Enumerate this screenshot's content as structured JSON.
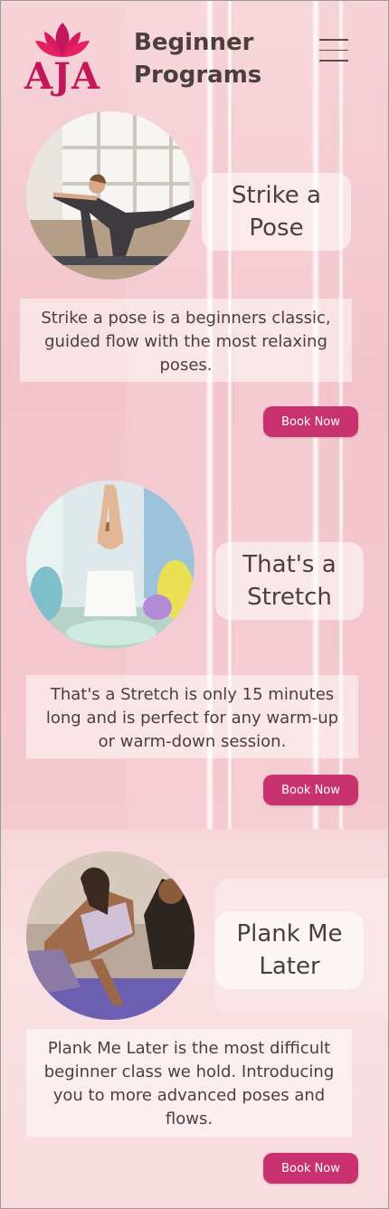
{
  "header": {
    "logo_text": "AJA",
    "title_line1": "Beginner",
    "title_line2": "Programs"
  },
  "colors": {
    "accent": "#c8336f",
    "logo": "#c2185b",
    "text": "#4a3e3e",
    "background": "#f3c4cc"
  },
  "programs": [
    {
      "title": "Strike a Pose",
      "description": "Strike a pose is a beginners classic, guided flow with the most relaxing poses.",
      "button_label": "Book Now"
    },
    {
      "title": "That's a Stretch",
      "description": "That's a Stretch is only 15 minutes long and is perfect for any warm-up or warm-down session.",
      "button_label": "Book Now"
    },
    {
      "title": "Plank Me Later",
      "description": "Plank Me Later is the most difficult beginner class we hold. Introducing you to more advanced poses and flows.",
      "button_label": "Book Now"
    }
  ],
  "icons": {
    "logo": "lotus-icon",
    "menu": "hamburger-menu-icon"
  }
}
